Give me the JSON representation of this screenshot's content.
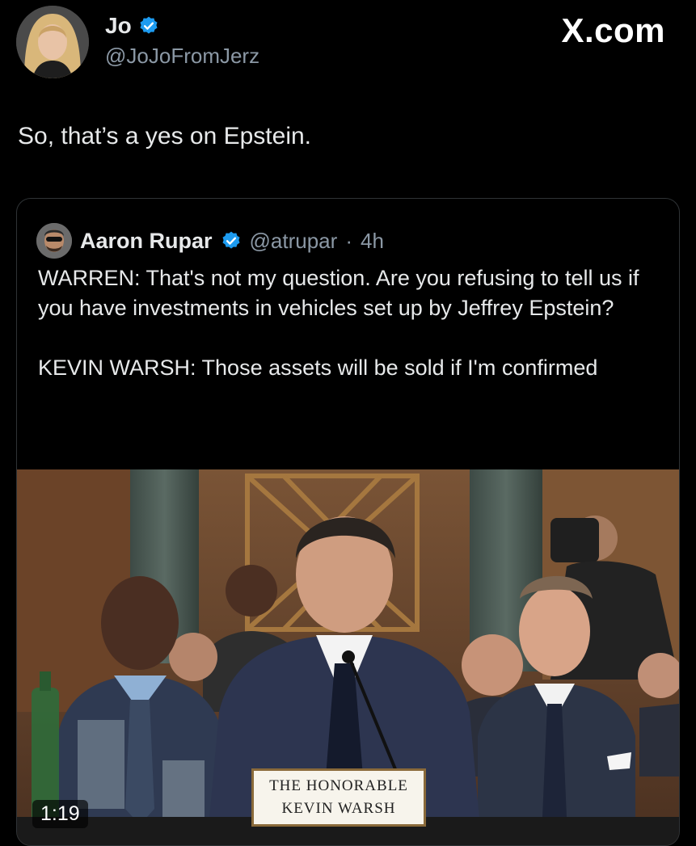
{
  "brand": "X.com",
  "author": {
    "display_name": "Jo",
    "handle": "@JoJoFromJerz",
    "verified": true
  },
  "tweet_text": "So, that’s a yes on Epstein.",
  "quoted": {
    "display_name": "Aaron Rupar",
    "handle": "@atrupar",
    "separator": "·",
    "time": "4h",
    "paragraphs": [
      "WARREN: That's not my question. Are you refusing to tell us if you have investments in vehicles set up by Jeffrey Epstein?",
      "KEVIN WARSH: Those assets will be sold if I'm confirmed"
    ],
    "video": {
      "nameplate_line1": "THE HONORABLE",
      "nameplate_line2": "KEVIN WARSH",
      "duration": "1:19"
    }
  },
  "colors": {
    "background": "#000000",
    "text": "#e7e9ea",
    "secondary_text": "#8b98a5",
    "verified_blue": "#1d9bf0",
    "border": "#2f3336"
  }
}
